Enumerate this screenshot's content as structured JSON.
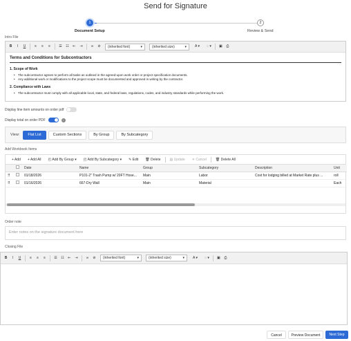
{
  "page": {
    "title": "Send for Signature"
  },
  "steps": [
    {
      "number": "1",
      "label": "Document Setup"
    },
    {
      "number": "2",
      "label": "Review & Send"
    }
  ],
  "intro_file": {
    "label": "Intro File",
    "font_select": "(inherited font)",
    "size_select": "(inherited size)",
    "heading": "Terms and Conditions for Subcontractors",
    "sections": [
      {
        "title": "1. Scope of Work",
        "items": [
          "The subcontractor agrees to perform all tasks as outlined in the agreed-upon work order or project specification documents.",
          "Any additional work or modifications to the project scope must be documented and approved in writing by the contractor."
        ]
      },
      {
        "title": "2. Compliance with Laws",
        "items": [
          "The subcontractor must comply with all applicable local, state, and federal laws, regulations, codes, and industry standards while performing the work."
        ]
      }
    ]
  },
  "toggles": {
    "line_item_amounts": {
      "label": "Display line item amounts on order pdf",
      "on": false
    },
    "total_on_order": {
      "label": "Display total on order PDF",
      "on": true,
      "info": "i"
    }
  },
  "view": {
    "label": "View:",
    "options": [
      "Flat List",
      "Custom Sections",
      "By Group",
      "By Subcategory"
    ],
    "selected": "Flat List"
  },
  "workbook": {
    "label": "Add Workbook Items",
    "toolbar": {
      "add": "+ Add",
      "add_all": "+ Add All",
      "add_by_group": "Add By Group",
      "add_by_subcategory": "Add By Subcategory",
      "edit": "Edit",
      "delete": "Delete",
      "update": "Update",
      "cancel": "Cancel",
      "delete_all": "Delete All"
    },
    "columns": [
      "Date",
      "Name",
      "Group",
      "Subcategory",
      "Description",
      "Unit"
    ],
    "rows": [
      {
        "date": "01/18/2026",
        "name": "P101-2\" Trash Pump w/ 20FT Hose...",
        "group": "Main",
        "subcategory": "Labor",
        "description": "Cost for lodging billed at Market Rate plus ...",
        "unit": "roll"
      },
      {
        "date": "01/16/2026",
        "name": "667-Dry Wall",
        "group": "Main",
        "subcategory": "Material",
        "description": "",
        "unit": "Each"
      }
    ]
  },
  "order_note": {
    "label": "Order note",
    "placeholder": "Enter notes on the signature document here"
  },
  "closing_file": {
    "label": "Closing File",
    "font_select": "(inherited font)",
    "size_select": "(inherited size)"
  },
  "footer": {
    "cancel": "Cancel",
    "preview": "Preview Document",
    "next": "Next Step"
  },
  "colors": {
    "accent": "#2d6ad6"
  }
}
